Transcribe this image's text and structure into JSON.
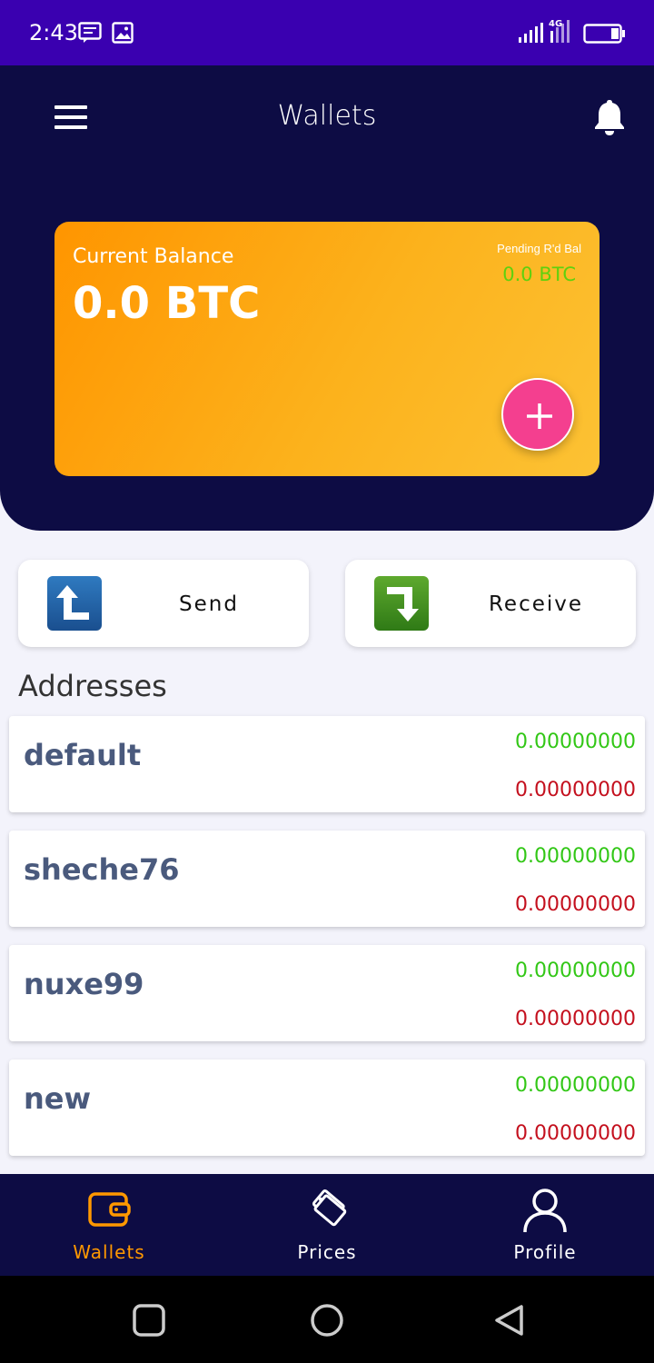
{
  "status_bar": {
    "time": "2:43",
    "network": "4G"
  },
  "header": {
    "title": "Wallets"
  },
  "balance_card": {
    "label": "Current Balance",
    "value": "0.0 BTC",
    "pending_label": "Pending R'd Bal",
    "pending_value": "0.0 BTC"
  },
  "actions": {
    "send_label": "Send",
    "receive_label": "Receive"
  },
  "addresses": {
    "title": "Addresses",
    "items": [
      {
        "name": "default",
        "green_value": "0.00000000",
        "red_value": "0.00000000"
      },
      {
        "name": "sheche76",
        "green_value": "0.00000000",
        "red_value": "0.00000000"
      },
      {
        "name": "nuxe99",
        "green_value": "0.00000000",
        "red_value": "0.00000000"
      },
      {
        "name": "new",
        "green_value": "0.00000000",
        "red_value": "0.00000000"
      }
    ]
  },
  "bottom_nav": {
    "items": [
      {
        "label": "Wallets",
        "icon": "wallet-icon",
        "active": true
      },
      {
        "label": "Prices",
        "icon": "tag-icon",
        "active": false
      },
      {
        "label": "Profile",
        "icon": "user-icon",
        "active": false
      }
    ]
  },
  "colors": {
    "status_bar": "#3a00b0",
    "header": "#0d0c44",
    "card_gradient_start": "#ff9500",
    "card_gradient_end": "#fcc234",
    "add_button": "#f43f8f",
    "positive": "#32c716",
    "negative": "#c4101e",
    "nav_active": "#ff9800"
  }
}
